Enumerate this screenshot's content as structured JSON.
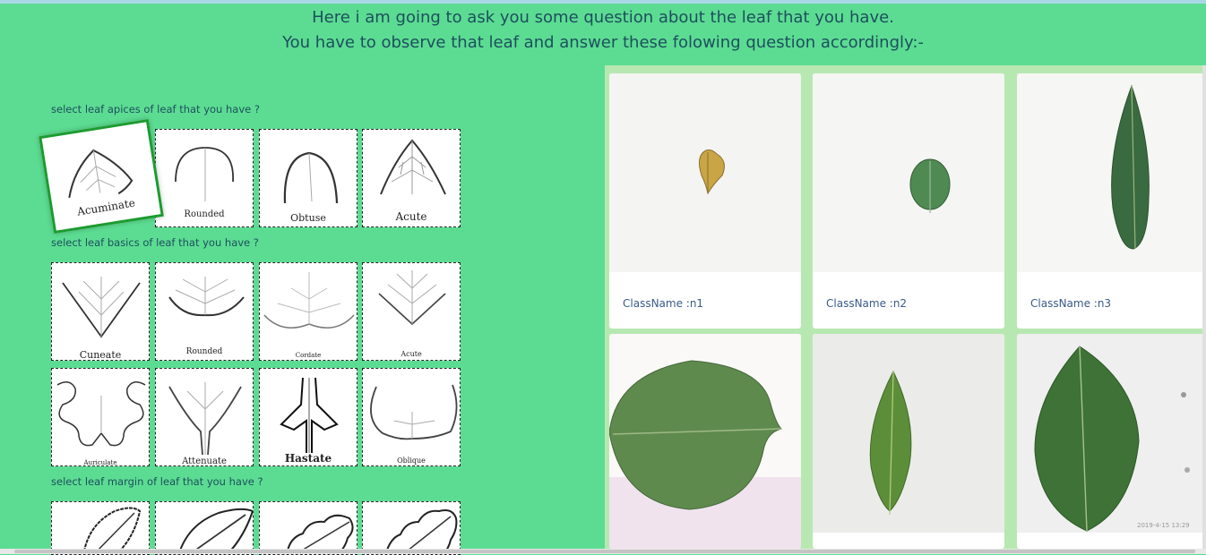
{
  "header": {
    "line1": "Here i am going to ask you some question about the leaf that you have.",
    "line2": "You have to observe that leaf and answer these folowing question accordingly:-"
  },
  "questions": {
    "apices": {
      "label": "select leaf apices of leaf that you have ?",
      "options": [
        "Acuminate",
        "Rounded",
        "Obtuse",
        "Acute"
      ]
    },
    "basics": {
      "label": "select leaf basics of leaf that you have ?",
      "options": [
        "Cuneate",
        "Rounded",
        "Cordate",
        "Acute",
        "Auriculate",
        "Attenuate",
        "Hastate",
        "Oblique"
      ]
    },
    "margin": {
      "label": "select leaf margin of leaf that you have ?"
    }
  },
  "gallery": {
    "cards": [
      {
        "classname": "ClassName :n1",
        "leaf": "yellow-ovate"
      },
      {
        "classname": "ClassName :n2",
        "leaf": "green-round"
      },
      {
        "classname": "ClassName :n3",
        "leaf": "long-lanceolate"
      },
      {
        "classname": "",
        "leaf": "broad-ovate"
      },
      {
        "classname": "",
        "leaf": "elliptic"
      },
      {
        "classname": "",
        "leaf": "large-elliptic",
        "timestamp": "2019-4-15 13:29"
      }
    ]
  },
  "colors": {
    "page_bg": "#5cdc92",
    "gallery_bg": "#b8e8b2",
    "header_text": "#1d4f5e",
    "selected_border": "#1c9b2f",
    "classname_text": "#3a5a8a"
  }
}
